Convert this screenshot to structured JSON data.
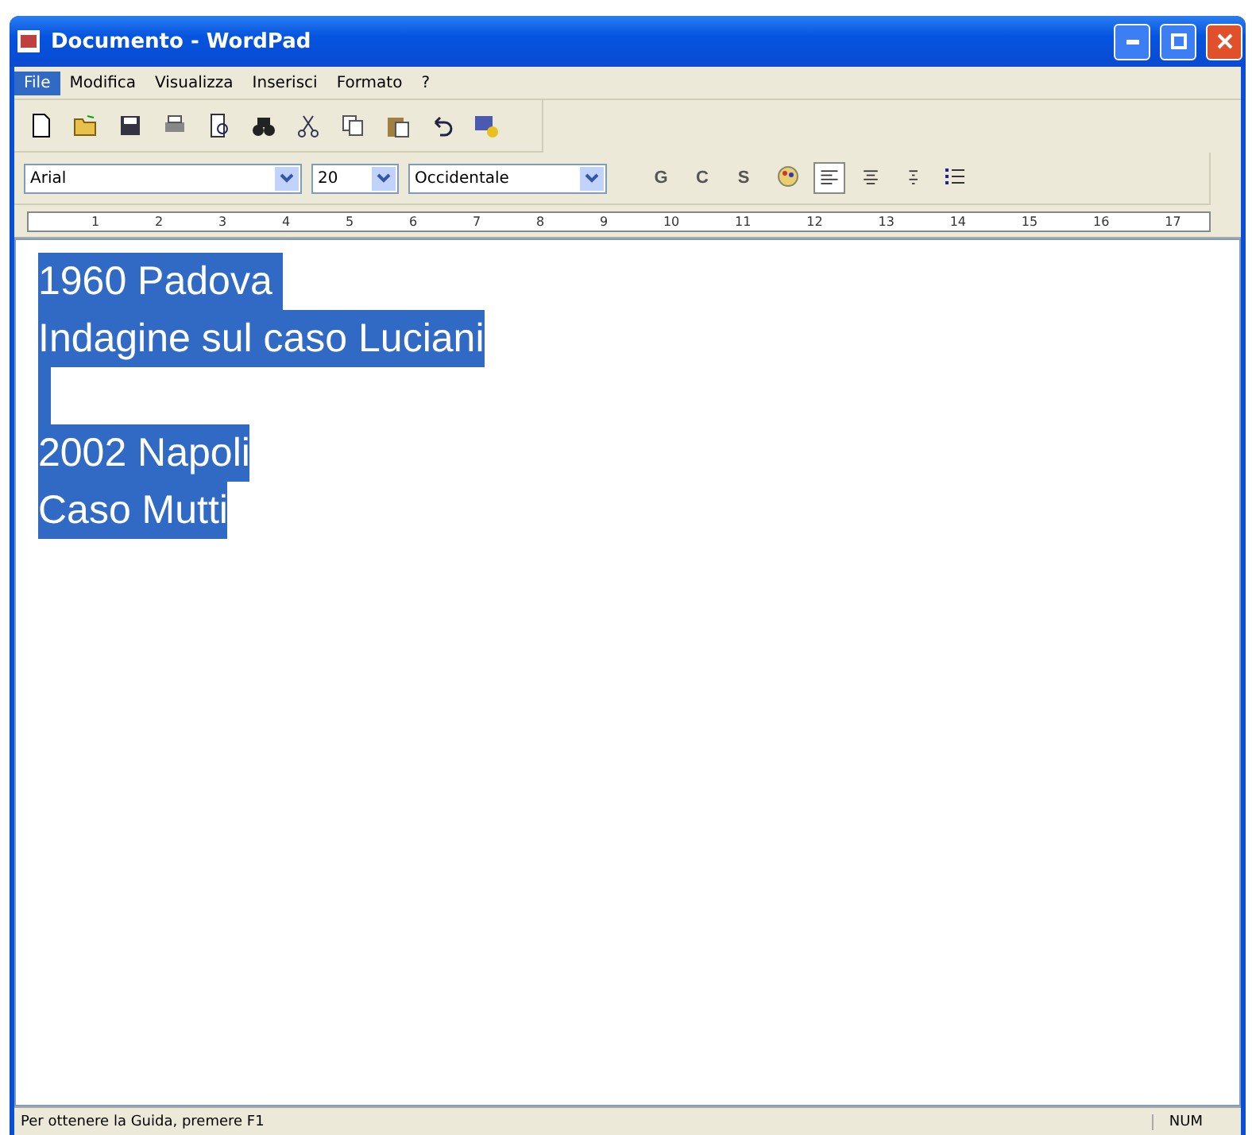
{
  "window": {
    "title": "Documento - WordPad"
  },
  "menu": [
    {
      "label": "File",
      "selected": true
    },
    {
      "label": "Modifica",
      "selected": false
    },
    {
      "label": "Visualizza",
      "selected": false
    },
    {
      "label": "Inserisci",
      "selected": false
    },
    {
      "label": "Formato",
      "selected": false
    },
    {
      "label": "?",
      "selected": false
    }
  ],
  "format_bar": {
    "font": "Arial",
    "size": "20",
    "script": "Occidentale",
    "style_buttons": [
      {
        "label": "G",
        "selected": false
      },
      {
        "label": "C",
        "selected": false
      },
      {
        "label": "S",
        "selected": false
      }
    ],
    "alignment": [
      {
        "kind": "left",
        "selected": true
      },
      {
        "kind": "center",
        "selected": false
      },
      {
        "kind": "right",
        "selected": false
      }
    ]
  },
  "ruler": [
    "1",
    "2",
    "3",
    "4",
    "5",
    "6",
    "7",
    "8",
    "9",
    "10",
    "11",
    "12",
    "13",
    "14",
    "15",
    "16",
    "17"
  ],
  "document": {
    "selected": true,
    "lines": [
      {
        "kind": "text",
        "text": "1960 Padova "
      },
      {
        "kind": "text",
        "text": "Indagine sul caso Luciani"
      },
      {
        "kind": "blank"
      },
      {
        "kind": "text",
        "text": "2002 Napoli"
      },
      {
        "kind": "text",
        "text": "Caso Mutti"
      }
    ]
  },
  "status_bar": {
    "help": "Per ottenere la Guida, premere F1",
    "indicator": "NUM"
  }
}
